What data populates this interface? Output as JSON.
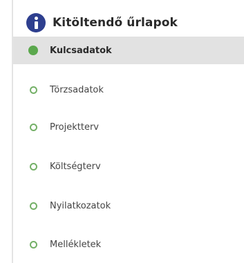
{
  "header": {
    "title": "Kitöltendő űrlapok",
    "icon": "info-icon",
    "icon_color": "#2e3f8f"
  },
  "menu": {
    "accent_color": "#5ba84d",
    "items": [
      {
        "label": "Kulcsadatok",
        "active": true
      },
      {
        "label": "Törzsadatok",
        "active": false
      },
      {
        "label": "Projektterv",
        "active": false
      },
      {
        "label": "Költségterv",
        "active": false
      },
      {
        "label": "Nyilatkozatok",
        "active": false
      },
      {
        "label": "Mellékletek",
        "active": false
      }
    ]
  }
}
